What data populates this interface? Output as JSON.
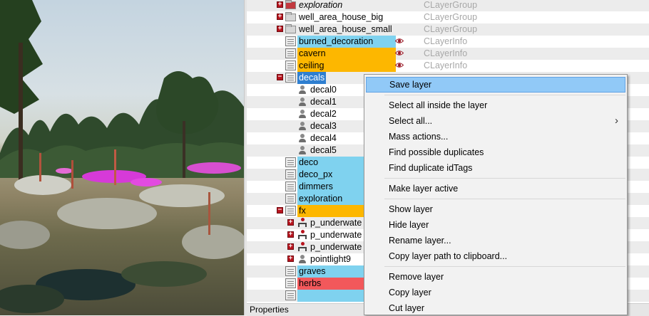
{
  "tree": {
    "rows": [
      {
        "name": "exploration",
        "type": "CLayerGroup",
        "kind": "group-special",
        "italic": true
      },
      {
        "name": "well_area_house_big",
        "type": "CLayerGroup",
        "kind": "group"
      },
      {
        "name": "well_area_house_small",
        "type": "CLayerGroup",
        "kind": "group"
      },
      {
        "name": "burned_decoration",
        "type": "CLayerInfo",
        "kind": "layer",
        "color": "blue",
        "eye": true
      },
      {
        "name": "cavern",
        "type": "CLayerInfo",
        "kind": "layer",
        "color": "orange",
        "eye": true
      },
      {
        "name": "ceiling",
        "type": "CLayerInfo",
        "kind": "layer",
        "color": "orange",
        "eye": true
      },
      {
        "name": "decals",
        "kind": "layer-open",
        "selected": true
      },
      {
        "name": "decal0",
        "kind": "entity"
      },
      {
        "name": "decal1",
        "kind": "entity"
      },
      {
        "name": "decal2",
        "kind": "entity"
      },
      {
        "name": "decal3",
        "kind": "entity"
      },
      {
        "name": "decal4",
        "kind": "entity"
      },
      {
        "name": "decal5",
        "kind": "entity"
      },
      {
        "name": "deco",
        "kind": "layer",
        "color": "blue"
      },
      {
        "name": "deco_px",
        "kind": "layer",
        "color": "blue"
      },
      {
        "name": "dimmers",
        "kind": "layer",
        "color": "blue"
      },
      {
        "name": "exploration",
        "kind": "layer",
        "color": "blue"
      },
      {
        "name": "fx",
        "kind": "layer-open",
        "color": "orange"
      },
      {
        "name": "p_underwate",
        "kind": "entity-group"
      },
      {
        "name": "p_underwate",
        "kind": "entity-group"
      },
      {
        "name": "p_underwate",
        "kind": "entity-group"
      },
      {
        "name": "pointlight9",
        "kind": "entity-closed"
      },
      {
        "name": "graves",
        "kind": "layer",
        "color": "blue"
      },
      {
        "name": "herbs",
        "kind": "layer",
        "color": "red"
      },
      {
        "name": "",
        "kind": "layer",
        "color": "blue"
      }
    ]
  },
  "properties_label": "Properties",
  "context_menu": {
    "items": [
      {
        "label": "Save layer",
        "highlight": true
      },
      {
        "sep": true
      },
      {
        "label": "Select all inside the layer"
      },
      {
        "label": "Select all...",
        "submenu": true
      },
      {
        "label": "Mass actions..."
      },
      {
        "label": "Find possible duplicates"
      },
      {
        "label": "Find duplicate idTags"
      },
      {
        "sep": true
      },
      {
        "label": "Make layer active"
      },
      {
        "sep": true
      },
      {
        "label": "Show layer"
      },
      {
        "label": "Hide layer"
      },
      {
        "label": "Rename layer..."
      },
      {
        "label": "Copy layer path to clipboard..."
      },
      {
        "sep": true
      },
      {
        "label": "Remove layer"
      },
      {
        "label": "Copy layer"
      },
      {
        "label": "Cut layer"
      }
    ]
  },
  "colors": {
    "blue": "#7fd2ef",
    "orange": "#fdb700",
    "red": "#f2585b",
    "selection": "#2f7fd0",
    "menu_highlight": "#91c9f7"
  }
}
